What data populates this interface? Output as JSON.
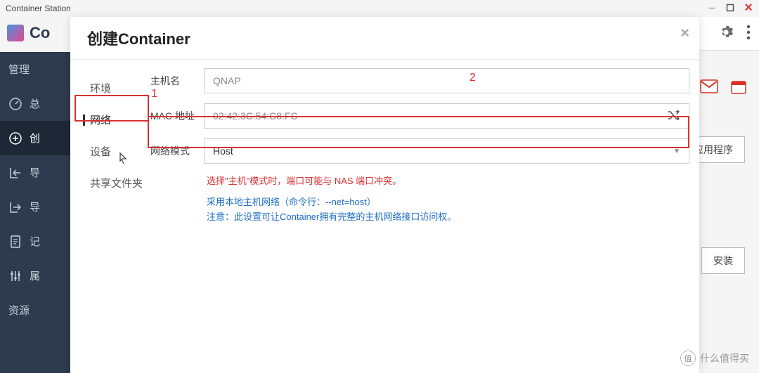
{
  "window": {
    "title": "Container Station"
  },
  "topbar": {
    "app_name": "Co"
  },
  "sidebar": {
    "items": [
      {
        "label": "管理",
        "icon": "manage"
      },
      {
        "label": "总",
        "icon": "dashboard"
      },
      {
        "label": "创",
        "icon": "create"
      },
      {
        "label": "导",
        "icon": "import"
      },
      {
        "label": "导",
        "icon": "export"
      },
      {
        "label": "记",
        "icon": "log"
      },
      {
        "label": "属",
        "icon": "settings"
      },
      {
        "label": "资源",
        "icon": "resource"
      }
    ]
  },
  "modal": {
    "title": "创建Container",
    "tabs": [
      {
        "label": "环境"
      },
      {
        "label": "网络"
      },
      {
        "label": "设备"
      },
      {
        "label": "共享文件夹"
      }
    ],
    "form": {
      "hostname_label": "主机名",
      "hostname_value": "QNAP",
      "mac_label": "MAC 地址",
      "mac_value": "02:42:3C:54:C8:FC",
      "network_label": "网络模式",
      "network_value": "Host",
      "warning": "选择\"主机\"模式时，端口可能与 NAS 端口冲突。",
      "info_line1": "采用本地主机网络（命令行：--net=host）",
      "info_line2": "注意：此设置可让Container拥有完整的主机网络接口访问权。"
    },
    "markers": {
      "one": "1",
      "two": "2"
    }
  },
  "background": {
    "btn1": "应用程序",
    "btn2": "安装"
  },
  "watermark": {
    "badge": "值",
    "text": "什么值得买"
  }
}
